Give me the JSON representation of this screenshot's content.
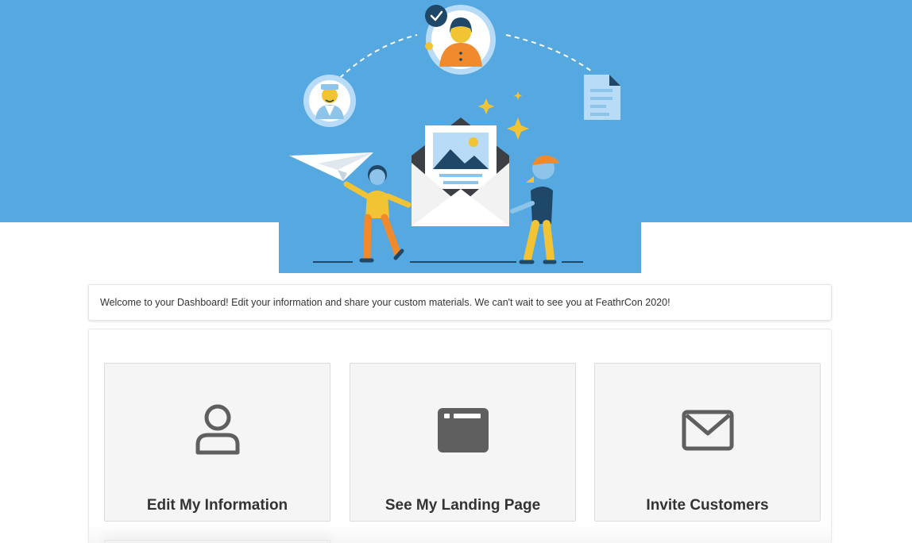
{
  "welcome": {
    "message": "Welcome to your Dashboard! Edit your information and share your custom materials. We can't wait to see you at FeathrCon 2020!"
  },
  "cards": [
    {
      "label": "Edit My Information",
      "icon": "user-icon"
    },
    {
      "label": "See My Landing Page",
      "icon": "browser-window-icon"
    },
    {
      "label": "Invite Customers",
      "icon": "envelope-icon"
    }
  ],
  "colors": {
    "hero_blue": "#56a8e1",
    "card_background": "#f5f5f5",
    "icon_gray": "#5f5f5f"
  }
}
